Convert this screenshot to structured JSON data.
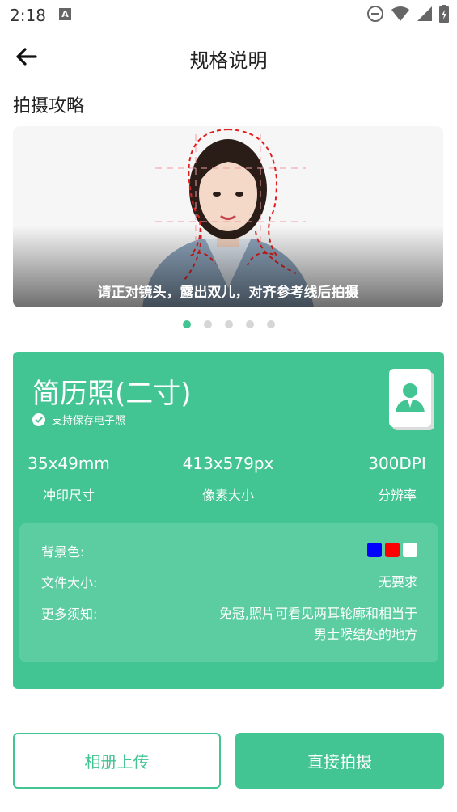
{
  "status_bar": {
    "time": "2:18",
    "icons": [
      "a-notification-icon",
      "do-not-disturb-icon",
      "wifi-icon",
      "signal-icon",
      "battery-icon"
    ]
  },
  "header": {
    "back_icon": "arrow-left-icon",
    "title": "规格说明"
  },
  "guide": {
    "heading": "拍摄攻略",
    "caption": "请正对镜头，露出双儿，对齐参考线后拍摄",
    "slide_count": 5,
    "active_slide": 0
  },
  "spec": {
    "name": "简历照(二寸)",
    "save_note": "支持保存电子照",
    "print_size": {
      "value": "35x49mm",
      "label": "冲印尺寸"
    },
    "pixel_size": {
      "value": "413x579px",
      "label": "像素大小"
    },
    "resolution": {
      "value": "300DPI",
      "label": "分辨率"
    },
    "details": {
      "background_label": "背景色:",
      "background_colors": [
        "#0000ff",
        "#ff0000",
        "#ffffff"
      ],
      "file_size_label": "文件大小:",
      "file_size_value": "无要求",
      "notes_label": "更多须知:",
      "notes_value_line1": "免冠,照片可看见两耳轮廓和相当于",
      "notes_value_line2": "男士喉结处的地方"
    }
  },
  "actions": {
    "upload_label": "相册上传",
    "shoot_label": "直接拍摄"
  },
  "colors": {
    "accent": "#43c493",
    "detail_box": "#5ccda1"
  }
}
